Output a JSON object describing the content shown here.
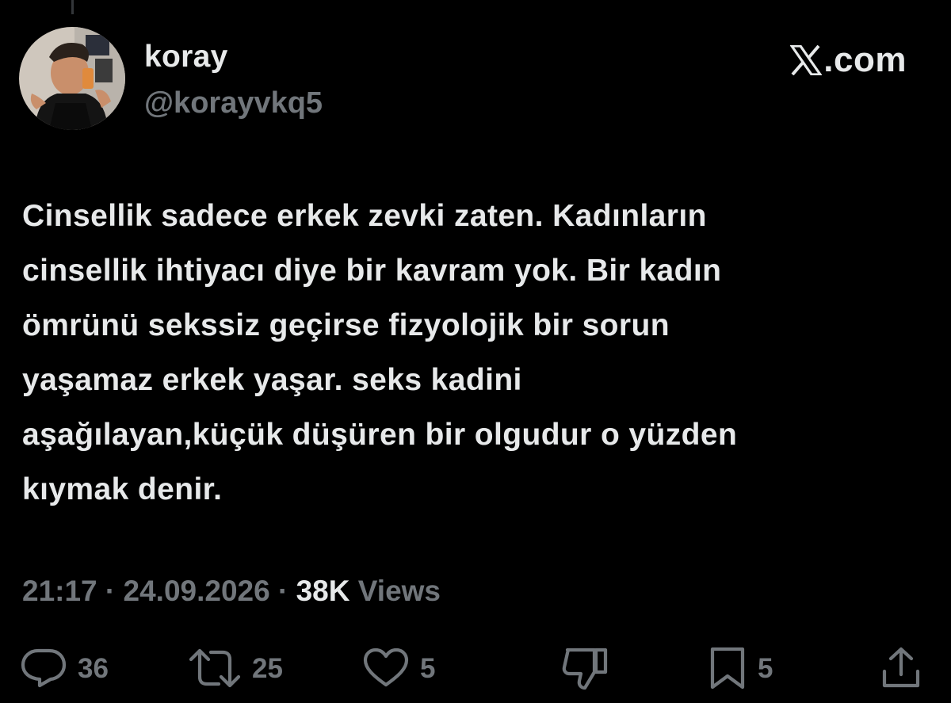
{
  "author": {
    "display_name": "koray",
    "handle": "@korayvkq5",
    "avatar_icon": "profile-photo"
  },
  "watermark": {
    "logo_icon": "x-logo-icon",
    "suffix": ".com"
  },
  "tweet": {
    "text": "Cinsellik sadece erkek zevki zaten. Kadınların\ncinsellik ihtiyacı diye bir kavram yok. Bir kadın\nömrünü sekssiz geçirse fizyolojik bir sorun\nyaşamaz erkek yaşar. seks kadini\naşağılayan,küçük düşüren bir olgudur o yüzden\nkıymak denir."
  },
  "meta": {
    "time": "21:17",
    "separator": "·",
    "date": "24.09.2026",
    "views_count": "38K",
    "views_label": "Views"
  },
  "actions": {
    "replies": "36",
    "reposts": "25",
    "likes": "5",
    "bookmarks": "5"
  },
  "colors": {
    "background": "#000000",
    "primary_text": "#e7e9ea",
    "secondary_text": "#71767b"
  }
}
